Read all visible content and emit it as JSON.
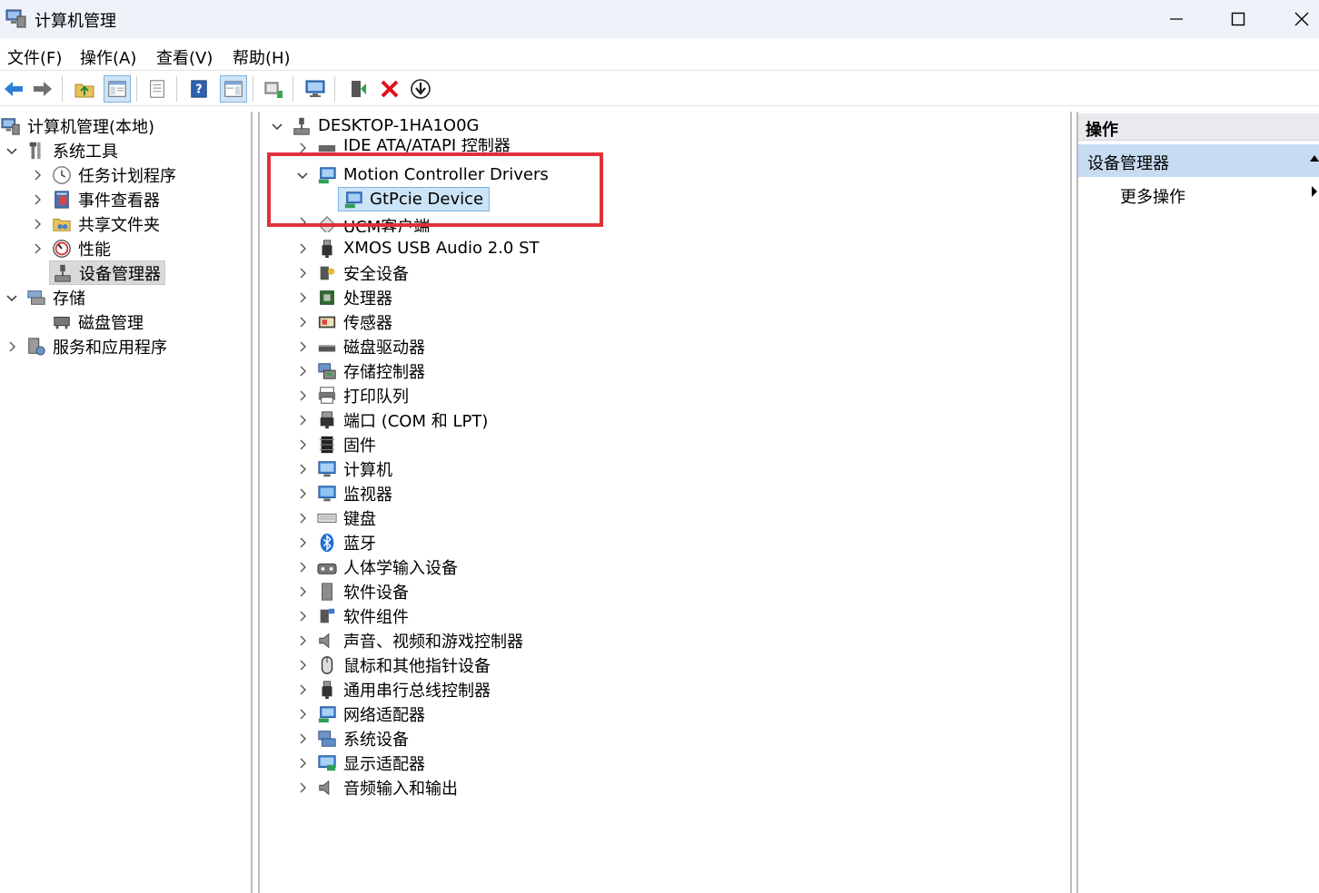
{
  "window": {
    "title": "计算机管理"
  },
  "menu": {
    "items": [
      "文件(F)",
      "操作(A)",
      "查看(V)",
      "帮助(H)"
    ]
  },
  "toolbar": {
    "buttons": [
      "back-icon",
      "forward-icon",
      "up-folder-icon",
      "show-hide-tree-icon",
      "properties-icon",
      "help-icon",
      "show-hide-action-pane-icon",
      "update-driver-icon",
      "scan-hardware-icon",
      "enable-device-icon",
      "uninstall-icon",
      "disable-device-icon"
    ]
  },
  "left_tree": {
    "root": "计算机管理(本地)",
    "system_tools": "系统工具",
    "task_scheduler": "任务计划程序",
    "event_viewer": "事件查看器",
    "shared_folders": "共享文件夹",
    "performance": "性能",
    "device_manager": "设备管理器",
    "storage": "存储",
    "disk_management": "磁盘管理",
    "services_apps": "服务和应用程序"
  },
  "device_tree": {
    "computer": "DESKTOP-1HA1O0G",
    "ide": "IDE ATA/ATAPI 控制器",
    "motion": "Motion Controller Drivers",
    "gtpcie": "GtPcie Device",
    "ucm": "UCM客户端",
    "xmos": "XMOS USB Audio 2.0 ST",
    "categories": [
      "安全设备",
      "处理器",
      "传感器",
      "磁盘驱动器",
      "存储控制器",
      "打印队列",
      "端口 (COM 和 LPT)",
      "固件",
      "计算机",
      "监视器",
      "键盘",
      "蓝牙",
      "人体学输入设备",
      "软件设备",
      "软件组件",
      "声音、视频和游戏控制器",
      "鼠标和其他指针设备",
      "通用串行总线控制器",
      "网络适配器",
      "系统设备",
      "显示适配器",
      "音频输入和输出"
    ]
  },
  "actions": {
    "header": "操作",
    "section": "设备管理器",
    "more": "更多操作"
  }
}
